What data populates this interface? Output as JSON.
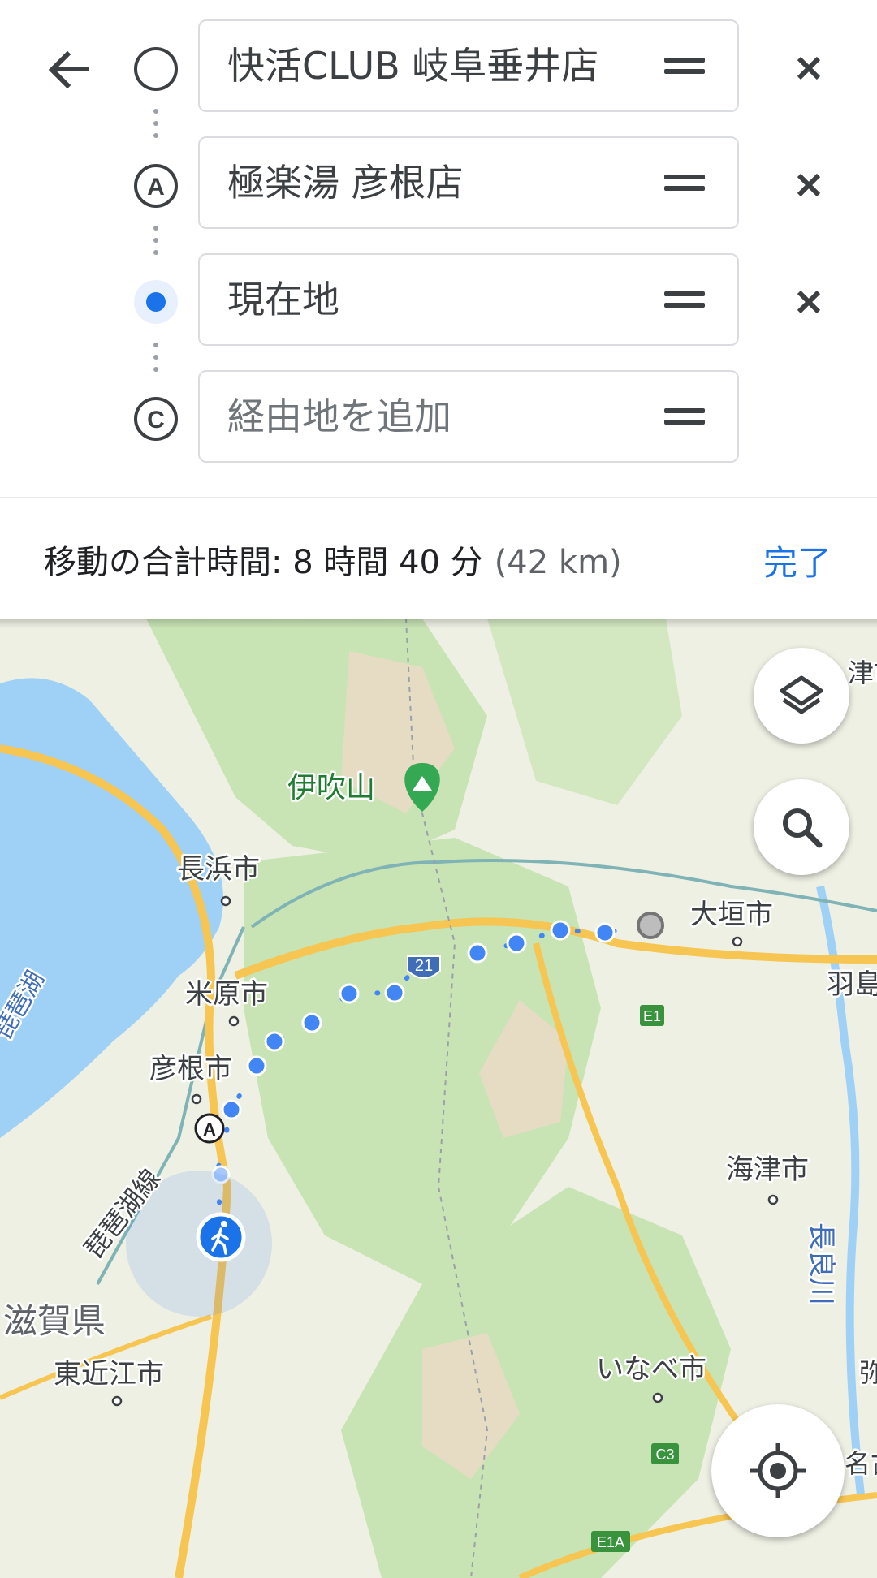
{
  "route": {
    "origin": "快活CLUB 岐阜垂井店",
    "stop_a": "極楽湯 彦根店",
    "stop_b": "現在地",
    "add_stop_placeholder": "経由地を追加",
    "marker_a": "A",
    "marker_c": "C"
  },
  "summary": {
    "label": "移動の合計時間: 8 時間 40 分",
    "distance": "(42 km)",
    "done": "完了"
  },
  "map": {
    "labels": {
      "ibukiyama": "伊吹山",
      "nagahama": "長浜市",
      "maibara": "米原市",
      "hikone": "彦根市",
      "ogaki": "大垣市",
      "kaizu": "海津市",
      "inabe": "いなべ市",
      "higashiomi": "東近江市",
      "shiga": "滋賀県",
      "biwako_line": "琵琶湖線",
      "nagaragawa": "長良川",
      "haji": "羽島",
      "lake": "琵琶湖",
      "edge_top_right": "津市",
      "edge_mid_right": "羽",
      "edge_bottom_right1": "弥",
      "edge_bottom_right2": "名古"
    },
    "shields": {
      "route21": "21",
      "e1": "E1",
      "c3": "C3",
      "e1a": "E1A"
    },
    "colors": {
      "water": "#9fd0f5",
      "land": "#eef0e4",
      "forest": "#c8e3b4",
      "highway": "#f6c552",
      "route": "#4285f4",
      "accent": "#1a73e8"
    }
  },
  "icons": {
    "back": "arrow-left-icon",
    "layers": "layers-icon",
    "search": "search-icon",
    "location": "my-location-icon",
    "walk": "walking-person-icon",
    "peak": "mountain-icon"
  }
}
